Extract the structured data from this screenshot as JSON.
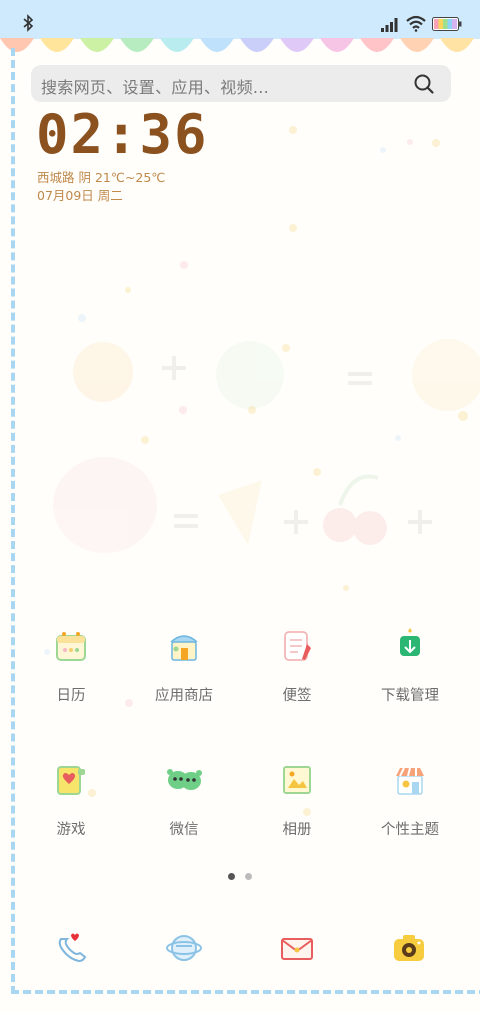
{
  "search": {
    "placeholder": "搜索网页、设置、应用、视频..."
  },
  "clock": {
    "time": "02:36"
  },
  "weather": {
    "text": "西城路  阴  21℃~25℃"
  },
  "date": {
    "text": "07月09日 周二"
  },
  "apps": [
    {
      "label": "日历",
      "icon": "calendar-icon"
    },
    {
      "label": "应用商店",
      "icon": "app-store-icon"
    },
    {
      "label": "便签",
      "icon": "notes-icon"
    },
    {
      "label": "下载管理",
      "icon": "download-manager-icon"
    },
    {
      "label": "游戏",
      "icon": "game-icon"
    },
    {
      "label": "微信",
      "icon": "wechat-icon"
    },
    {
      "label": "相册",
      "icon": "gallery-icon"
    },
    {
      "label": "个性主题",
      "icon": "themes-icon"
    }
  ],
  "dock": [
    {
      "icon": "phone-icon"
    },
    {
      "icon": "browser-icon"
    },
    {
      "icon": "messages-icon"
    },
    {
      "icon": "camera-icon"
    }
  ],
  "pages": {
    "count": 2,
    "current": 1
  },
  "colors": {
    "status_bar": "#cfeafd",
    "clock": "#8b5220",
    "weather_text": "#c0884a",
    "frame": "#a9d7f1"
  }
}
